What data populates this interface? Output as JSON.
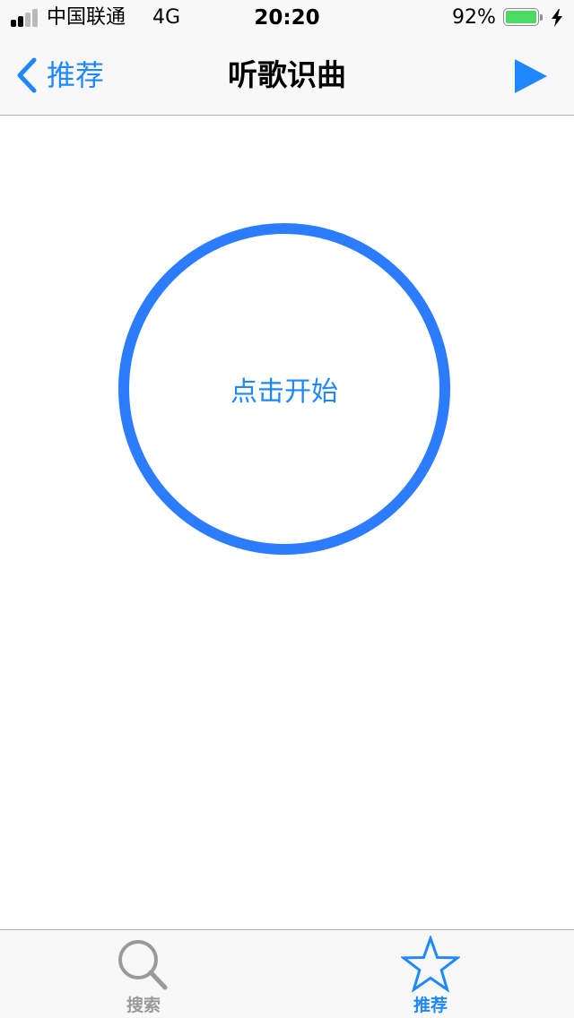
{
  "status_bar": {
    "carrier": "中国联通",
    "network": "4G",
    "time": "20:20",
    "battery_percent": "92%",
    "battery_level": 0.92,
    "battery_color": "#4cd964",
    "signal_bars_filled": 2,
    "signal_bars_total": 4
  },
  "nav_bar": {
    "back_label": "推荐",
    "title": "听歌识曲",
    "back_icon": "chevron-left-icon",
    "action_icon": "play-icon"
  },
  "main": {
    "start_label": "点击开始"
  },
  "tab_bar": {
    "tabs": [
      {
        "label": "搜索",
        "icon": "search-icon",
        "selected": false
      },
      {
        "label": "推荐",
        "icon": "star-icon",
        "selected": true
      }
    ]
  },
  "colors": {
    "accent": "#1f87ff",
    "circle": "#2b7cff",
    "inactive_tab": "#9a9a9a"
  }
}
